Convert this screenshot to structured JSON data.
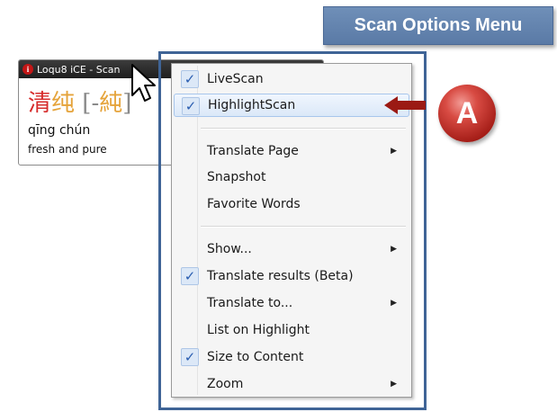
{
  "banner": {
    "title": "Scan Options Menu"
  },
  "popup": {
    "title": "Loqu8 iCE - Scan",
    "info_glyph": "i",
    "hanzi_char1": "清",
    "hanzi_char2": "纯",
    "bracket_open": "[-",
    "hanzi_trad": "純",
    "bracket_close": "]",
    "pinyin": "qīng chún",
    "definition": "fresh and pure"
  },
  "menu": {
    "items": [
      {
        "label": "LiveScan",
        "checked": true
      },
      {
        "label": "HighlightScan",
        "checked": true,
        "highlighted": true
      },
      {
        "label": "Translate Page",
        "submenu": true
      },
      {
        "label": "Snapshot"
      },
      {
        "label": "Favorite Words"
      },
      {
        "label": "Show...",
        "submenu": true
      },
      {
        "label": "Translate results (Beta)",
        "checked": true
      },
      {
        "label": "Translate to...",
        "submenu": true
      },
      {
        "label": "List on Highlight"
      },
      {
        "label": "Size to Content",
        "checked": true
      },
      {
        "label": "Zoom",
        "submenu": true
      }
    ],
    "check_glyph": "✓",
    "submenu_glyph": "▶"
  },
  "callout": {
    "badge": "A"
  },
  "colors": {
    "banner": "#5f80ad",
    "frame": "#3f6496",
    "arrow": "#9b1a14",
    "badge": "#c0302a",
    "check": "#2a5db0"
  }
}
